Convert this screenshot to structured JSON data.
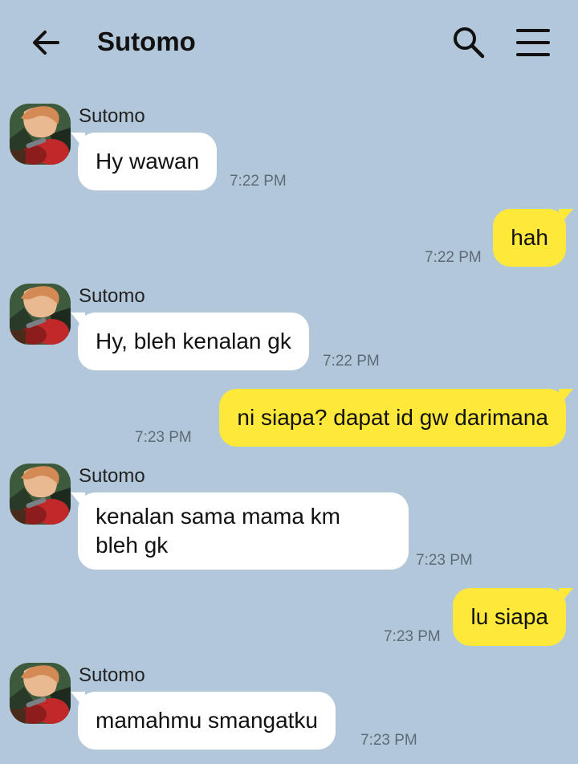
{
  "header": {
    "title": "Sutomo",
    "back_icon": "arrow-left-icon",
    "search_icon": "search-icon",
    "menu_icon": "hamburger-menu-icon"
  },
  "colors": {
    "background": "#b3c7db",
    "incoming_bubble": "#ffffff",
    "outgoing_bubble": "#fee83a",
    "timestamp": "#5d6b78"
  },
  "messages": [
    {
      "direction": "incoming",
      "sender": "Sutomo",
      "text": "Hy wawan",
      "time": "7:22 PM"
    },
    {
      "direction": "outgoing",
      "text": "hah",
      "time": "7:22 PM"
    },
    {
      "direction": "incoming",
      "sender": "Sutomo",
      "text": "Hy, bleh kenalan gk",
      "time": "7:22 PM"
    },
    {
      "direction": "outgoing",
      "text": "ni siapa? dapat id gw darimana",
      "time": "7:23 PM"
    },
    {
      "direction": "incoming",
      "sender": "Sutomo",
      "text_lines": [
        "kenalan sama mama km",
        "bleh gk"
      ],
      "time": "7:23 PM"
    },
    {
      "direction": "outgoing",
      "text": "lu siapa",
      "time": "7:23 PM"
    },
    {
      "direction": "incoming",
      "sender": "Sutomo",
      "text": "mamahmu smangatku",
      "time": "7:23 PM"
    }
  ]
}
